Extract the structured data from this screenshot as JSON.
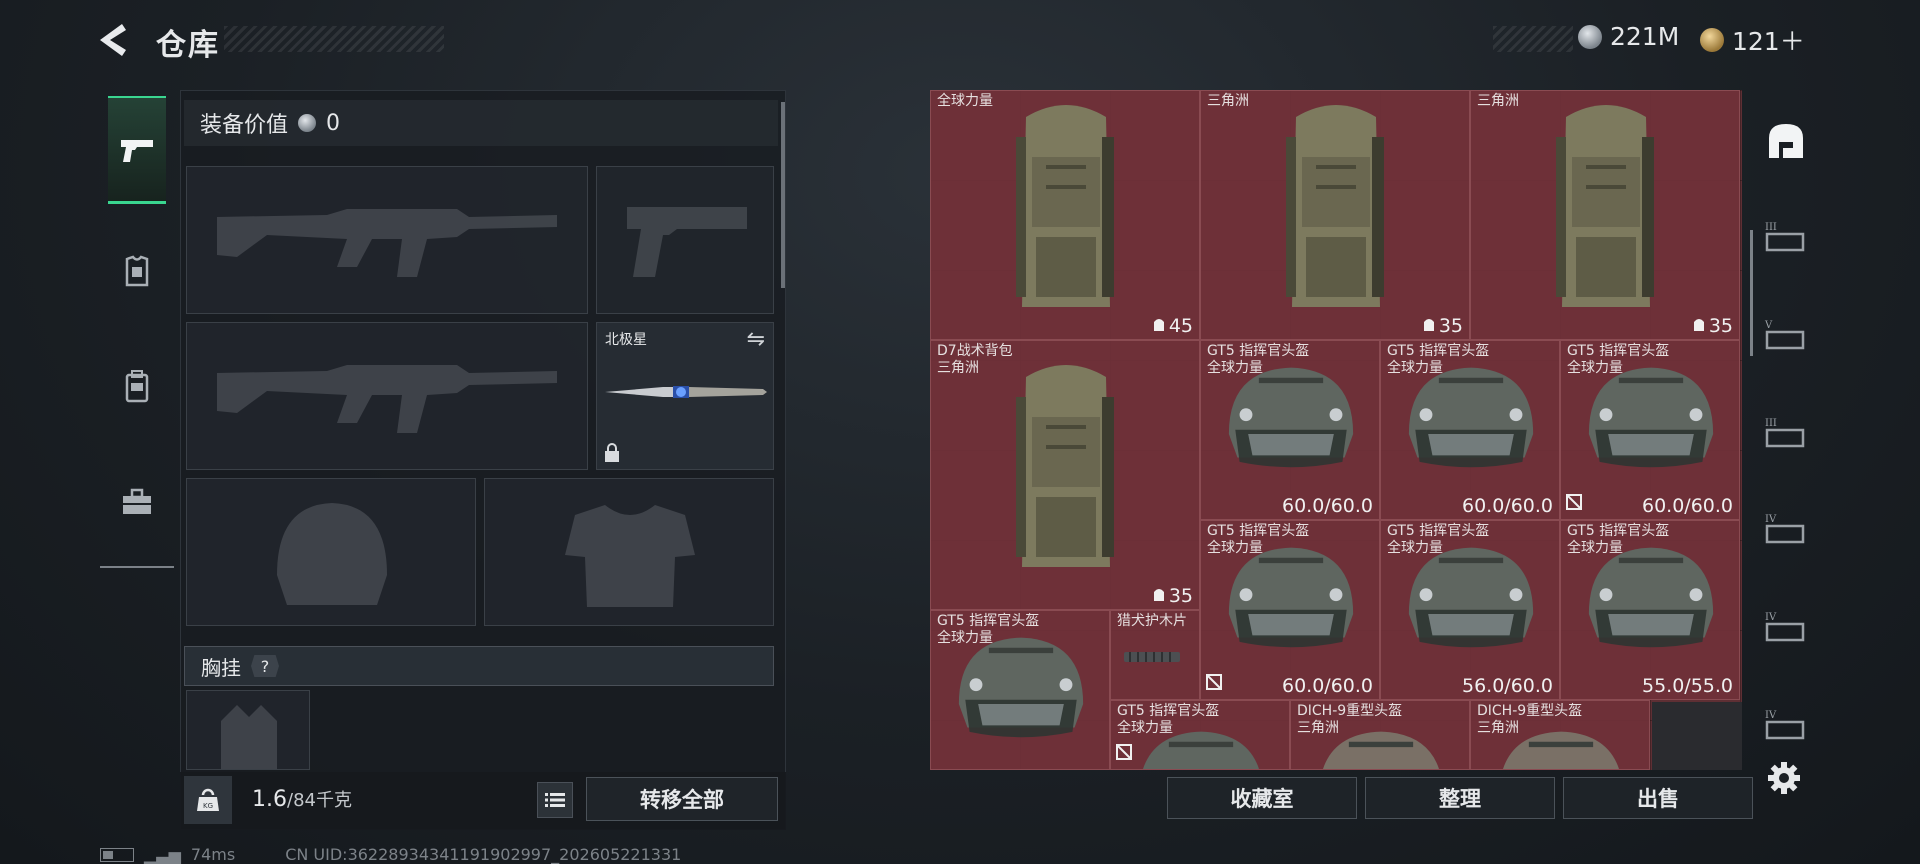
{
  "header": {
    "title": "仓库"
  },
  "currency": [
    {
      "icon": "silver-coin-icon",
      "value": "221M"
    },
    {
      "icon": "gold-coin-icon",
      "value": "121＋"
    }
  ],
  "tabs": [
    {
      "icon": "pistol-icon",
      "active": true
    },
    {
      "icon": "armor-icon",
      "active": false
    },
    {
      "icon": "backpack-icon",
      "active": false
    },
    {
      "icon": "case-icon",
      "active": false
    }
  ],
  "loadout": {
    "equip_value_label": "装备价值",
    "equip_value": "0",
    "knife_name": "北极星",
    "chest_label": "胸挂",
    "chest_help": "?"
  },
  "weight": {
    "current": "1.6",
    "max": "/84千克"
  },
  "buttons": {
    "transfer_all": "转移全部",
    "collection": "收藏室",
    "sort": "整理",
    "sell": "出售"
  },
  "stash_items": [
    {
      "name": "",
      "sub": "全球力量",
      "value": "45",
      "kind": "backpack"
    },
    {
      "name": "",
      "sub": "三角洲",
      "value": "35",
      "kind": "backpack"
    },
    {
      "name": "",
      "sub": "三角洲",
      "value": "35",
      "kind": "backpack"
    },
    {
      "name": "D7战术背包",
      "sub": "三角洲",
      "value": "35",
      "kind": "backpack"
    },
    {
      "name": "GT5 指挥官头盔",
      "sub": "全球力量",
      "value": "60.0/60.0",
      "kind": "helmet"
    },
    {
      "name": "GT5 指挥官头盔",
      "sub": "全球力量",
      "value": "60.0/60.0",
      "kind": "helmet"
    },
    {
      "name": "GT5 指挥官头盔",
      "sub": "全球力量",
      "value": "60.0/60.0",
      "kind": "helmet"
    },
    {
      "name": "GT5 指挥官头盔",
      "sub": "全球力量",
      "value": "60.0/60.0",
      "kind": "helmet"
    },
    {
      "name": "GT5 指挥官头盔",
      "sub": "全球力量",
      "value": "56.0/60.0",
      "kind": "helmet"
    },
    {
      "name": "GT5 指挥官头盔",
      "sub": "全球力量",
      "value": "55.0/55.0",
      "kind": "helmet"
    },
    {
      "name": "GT5 指挥官头盔",
      "sub": "全球力量",
      "value": "",
      "kind": "helmet"
    },
    {
      "name": "猎犬护木片",
      "sub": "",
      "value": "",
      "kind": "part"
    },
    {
      "name": "GT5 指挥官头盔",
      "sub": "全球力量",
      "value": "",
      "kind": "helmet"
    },
    {
      "name": "DICH-9重型头盔",
      "sub": "三角洲",
      "value": "",
      "kind": "helmet-heavy"
    },
    {
      "name": "DICH-9重型头盔",
      "sub": "三角洲",
      "value": "",
      "kind": "helmet-heavy"
    }
  ],
  "status": {
    "ping": "74ms",
    "uid": "CN UID:3622893434119190​2997_202605221331"
  }
}
